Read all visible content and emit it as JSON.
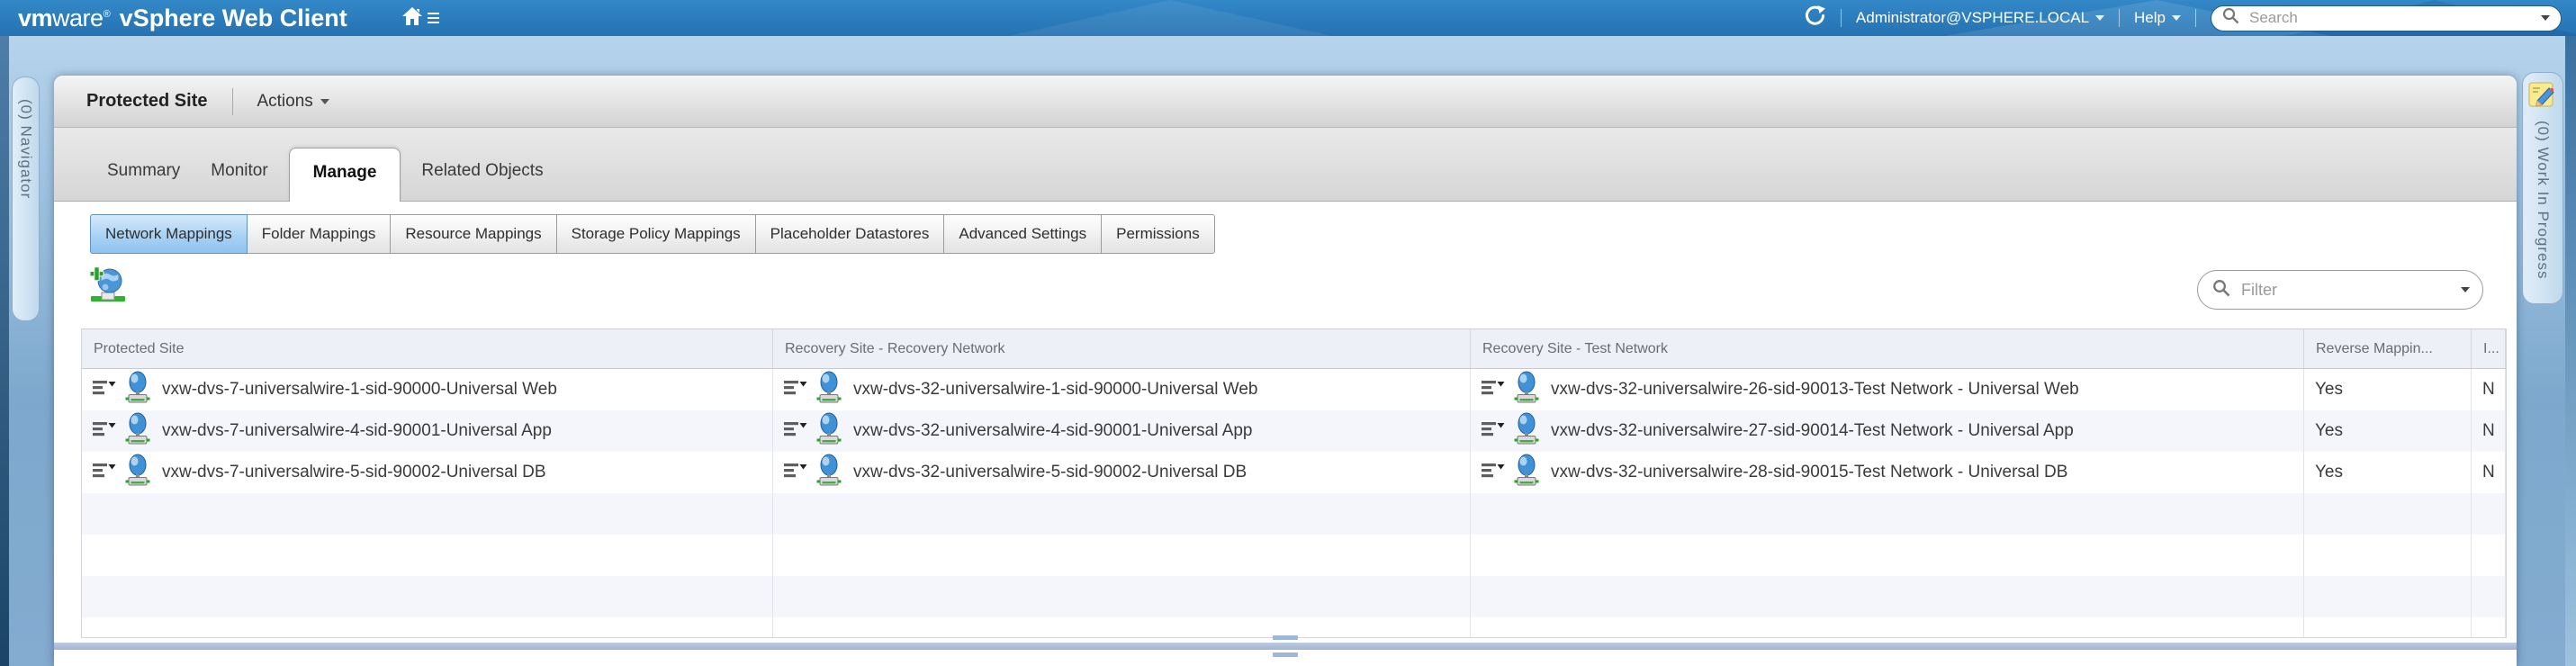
{
  "banner": {
    "logo": {
      "vm": "vm",
      "ware": "ware",
      "reg": "®",
      "product": "vSphere Web Client"
    },
    "user_menu_label": "Administrator@VSPHERE.LOCAL",
    "help_label": "Help",
    "search_placeholder": "Search"
  },
  "left_panel": {
    "label": "(0) Navigator"
  },
  "right_panel": {
    "label": "(0) Work In Progress"
  },
  "object_header": {
    "title": "Protected Site",
    "actions_label": "Actions"
  },
  "tabs": [
    {
      "label": "Summary",
      "active": false
    },
    {
      "label": "Monitor",
      "active": false
    },
    {
      "label": "Manage",
      "active": true
    },
    {
      "label": "Related Objects",
      "active": false
    }
  ],
  "subtabs": [
    {
      "label": "Network Mappings",
      "active": true
    },
    {
      "label": "Folder Mappings",
      "active": false
    },
    {
      "label": "Resource Mappings",
      "active": false
    },
    {
      "label": "Storage Policy Mappings",
      "active": false
    },
    {
      "label": "Placeholder Datastores",
      "active": false
    },
    {
      "label": "Advanced Settings",
      "active": false
    },
    {
      "label": "Permissions",
      "active": false
    }
  ],
  "toolbar": {
    "filter_placeholder": "Filter"
  },
  "table": {
    "columns": [
      {
        "label": "Protected Site"
      },
      {
        "label": "Recovery Site - Recovery Network"
      },
      {
        "label": "Recovery Site - Test Network"
      },
      {
        "label": "Reverse Mappin..."
      },
      {
        "label": "I..."
      }
    ],
    "rows": [
      {
        "protected_site": "vxw-dvs-7-universalwire-1-sid-90000-Universal Web",
        "recovery_network": "vxw-dvs-32-universalwire-1-sid-90000-Universal Web",
        "test_network": "vxw-dvs-32-universalwire-26-sid-90013-Test Network - Universal Web",
        "reverse_mapping": "Yes",
        "last_col": "N"
      },
      {
        "protected_site": "vxw-dvs-7-universalwire-4-sid-90001-Universal App",
        "recovery_network": "vxw-dvs-32-universalwire-4-sid-90001-Universal App",
        "test_network": "vxw-dvs-32-universalwire-27-sid-90014-Test Network - Universal App",
        "reverse_mapping": "Yes",
        "last_col": "N"
      },
      {
        "protected_site": "vxw-dvs-7-universalwire-5-sid-90002-Universal DB",
        "recovery_network": "vxw-dvs-32-universalwire-5-sid-90002-Universal DB",
        "test_network": "vxw-dvs-32-universalwire-28-sid-90015-Test Network - Universal DB",
        "reverse_mapping": "Yes",
        "last_col": "N"
      }
    ],
    "empty_row_count": 4
  },
  "colors": {
    "banner_blue": "#2b7cbc",
    "subtab_active": "#8fc2ee",
    "table_header_bg": "#eef0f8",
    "row_alt_bg": "#f5f6fc",
    "splitter": "#aebfdc"
  }
}
